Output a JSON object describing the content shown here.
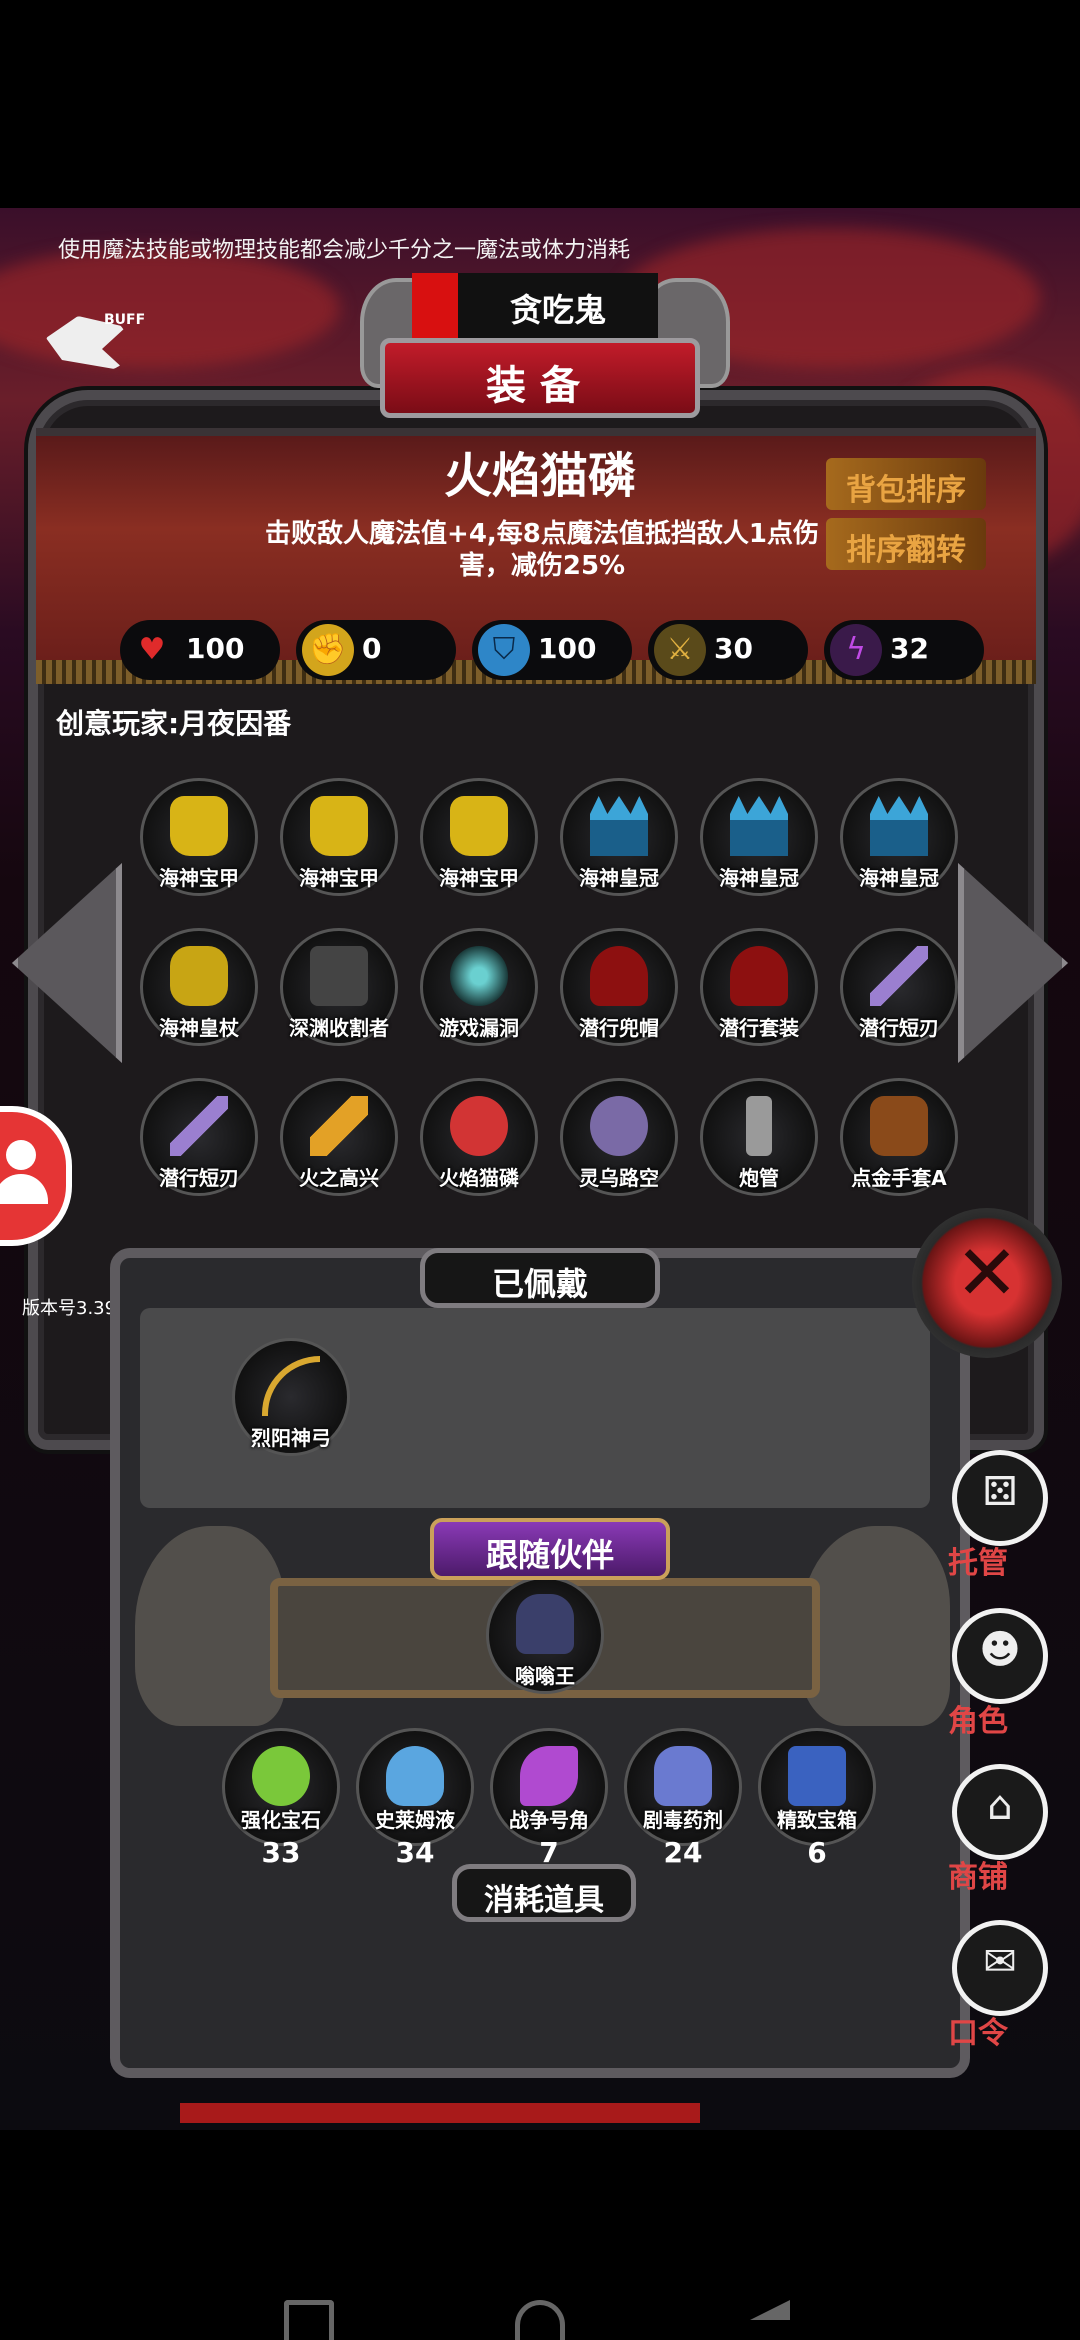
{
  "tip": "使用魔法技能或物理技能都会减少千分之一魔法或体力消耗",
  "buff_logo_text": "BUFF",
  "top_name": "贪吃鬼",
  "title": "装备",
  "item": {
    "name": "火焰猫磷",
    "description": "击败敌人魔法值+4,每8点魔法值抵挡敌人1点伤害，减伤25%"
  },
  "buttons": {
    "sort_bag": "背包排序",
    "sort_reverse": "排序翻转"
  },
  "stats": [
    {
      "icon": "heart-icon",
      "value": "100",
      "color": "#e02b2b"
    },
    {
      "icon": "strength-icon",
      "value": "0",
      "color": "#d3a51c"
    },
    {
      "icon": "armor-icon",
      "value": "100",
      "color": "#2e86c8"
    },
    {
      "icon": "attack-icon",
      "value": "30",
      "color": "#c89a2a"
    },
    {
      "icon": "speed-icon",
      "value": "32",
      "color": "#a03ad6"
    }
  ],
  "creator": "创意玩家:月夜因番",
  "inventory": [
    {
      "label": "海神宝甲",
      "icon": "armor"
    },
    {
      "label": "海神宝甲",
      "icon": "armor"
    },
    {
      "label": "海神宝甲",
      "icon": "armor"
    },
    {
      "label": "海神皇冠",
      "icon": "crown"
    },
    {
      "label": "海神皇冠",
      "icon": "crown"
    },
    {
      "label": "海神皇冠",
      "icon": "crown"
    },
    {
      "label": "海神皇杖",
      "icon": "scepter"
    },
    {
      "label": "深渊收割者",
      "icon": "reaper"
    },
    {
      "label": "游戏漏洞",
      "icon": "portal"
    },
    {
      "label": "潜行兜帽",
      "icon": "hood"
    },
    {
      "label": "潜行套装",
      "icon": "hood"
    },
    {
      "label": "潜行短刃",
      "icon": "blade"
    },
    {
      "label": "潜行短刃",
      "icon": "blade"
    },
    {
      "label": "火之高兴",
      "icon": "fireblade"
    },
    {
      "label": "火焰猫磷",
      "icon": "girl"
    },
    {
      "label": "灵乌路空",
      "icon": "girl2"
    },
    {
      "label": "炮管",
      "icon": "pipe"
    },
    {
      "label": "点金手套A",
      "icon": "glove"
    }
  ],
  "version": "版本号3.39",
  "worn_title": "已佩戴",
  "worn_items": [
    {
      "label": "烈阳神弓"
    }
  ],
  "follow_title": "跟随伙伴",
  "follower": {
    "label": "嗡嗡王"
  },
  "consumables_title": "消耗道具",
  "consumables": [
    {
      "label": "强化宝石",
      "count": "33",
      "color": "#7ac83a"
    },
    {
      "label": "史莱姆液",
      "count": "34",
      "color": "#5aa6e0"
    },
    {
      "label": "战争号角",
      "count": "7",
      "color": "#b04ad0"
    },
    {
      "label": "剧毒药剂",
      "count": "24",
      "color": "#6a7ad0"
    },
    {
      "label": "精致宝箱",
      "count": "6",
      "color": "#3a62c0"
    }
  ],
  "right_menu": [
    {
      "label": "托管",
      "icon": "dice-icon"
    },
    {
      "label": "角色",
      "icon": "character-icon"
    },
    {
      "label": "商铺",
      "icon": "shop-icon"
    },
    {
      "label": "口令",
      "icon": "scroll-icon"
    }
  ]
}
